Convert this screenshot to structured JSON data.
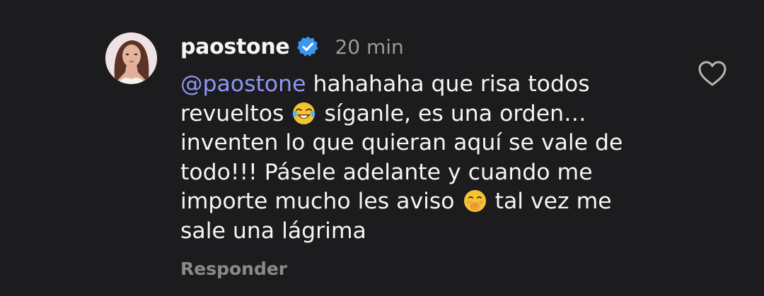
{
  "comment": {
    "username": "paostone",
    "timestamp": "20 min",
    "mention": "@paostone",
    "lines": [
      "hahahaha que risa todos",
      "revueltos",
      "síganle, es una orden…",
      "inventen lo que quieran aquí se vale de",
      "todo!!! Pásele adelante y cuando me",
      "importe mucho les aviso",
      "tal vez me",
      "sale una lágrima"
    ],
    "reply_label": "Responder",
    "verified_icon": "verified-badge-icon",
    "like_icon": "heart-outline-icon",
    "emoji_1": "face-with-tears-of-joy-emoji",
    "emoji_2": "face-with-hand-over-mouth-emoji"
  },
  "colors": {
    "background": "#1c1c1e",
    "text": "#f5f5f5",
    "mention": "#8f96f4",
    "muted": "#9a9a9a",
    "verified": "#3897f0"
  }
}
